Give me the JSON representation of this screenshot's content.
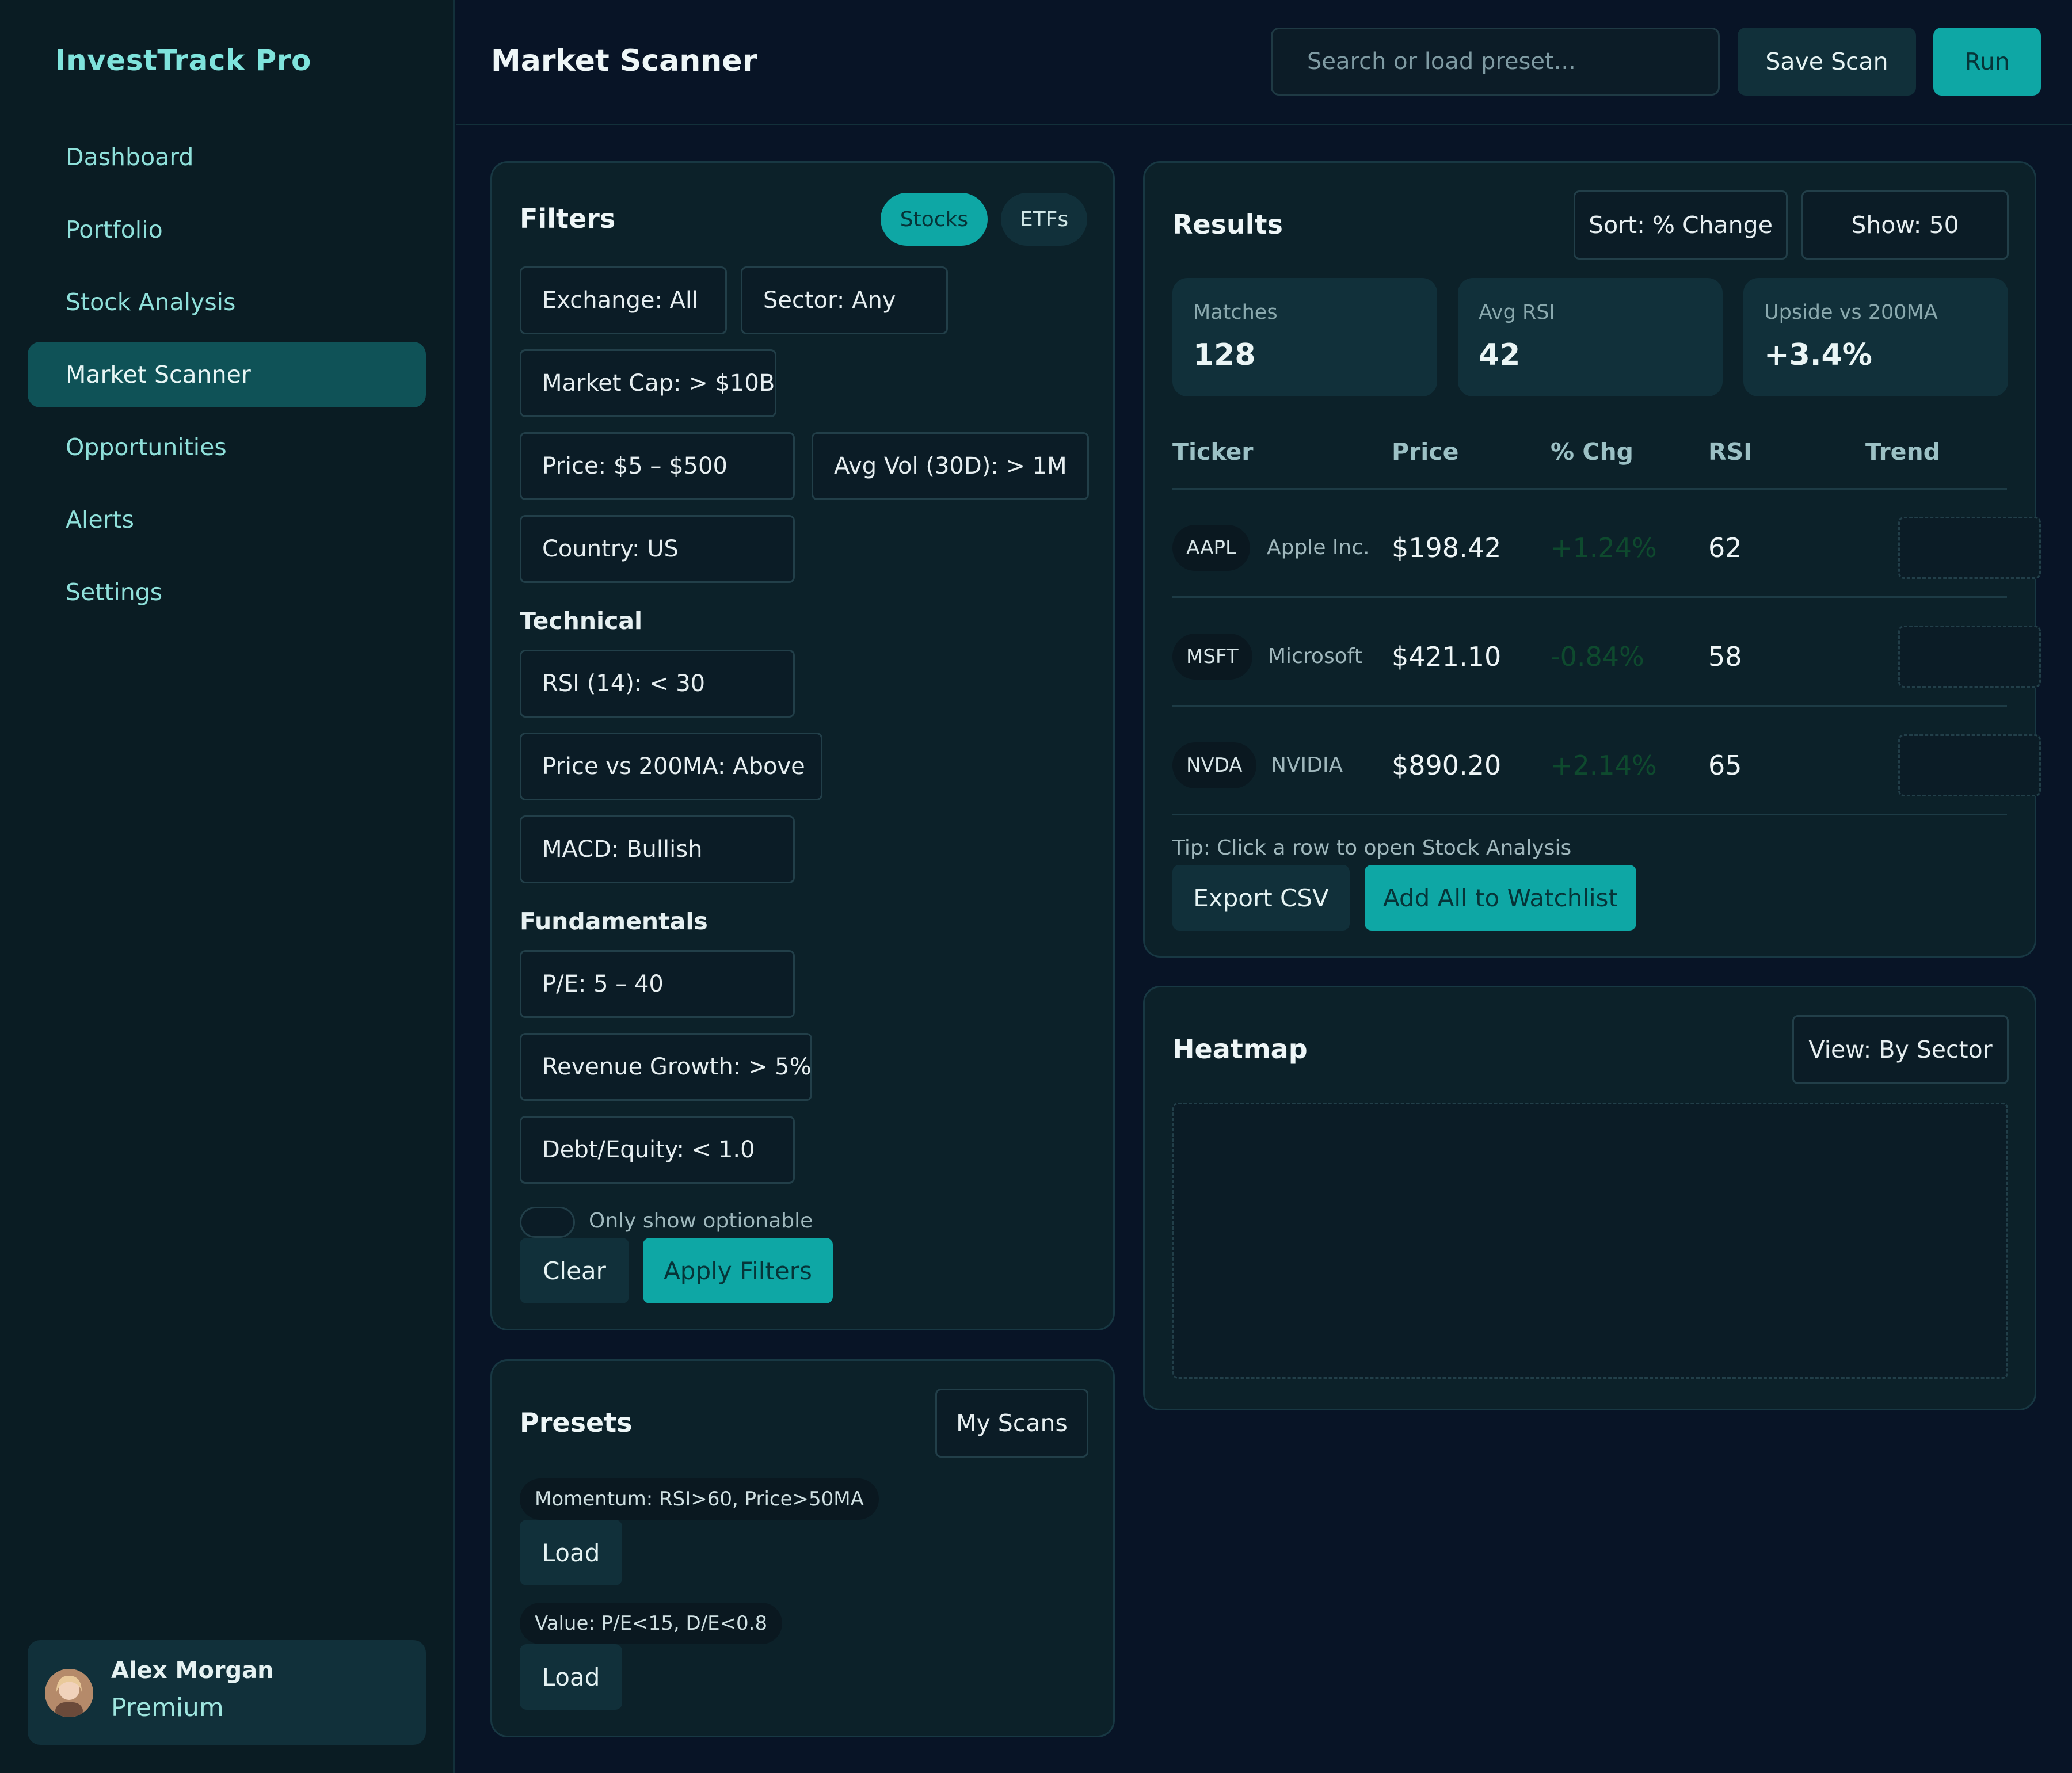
{
  "app": {
    "brand": "InvestTrack Pro"
  },
  "sidebar": {
    "items": [
      {
        "label": "Dashboard",
        "active": false
      },
      {
        "label": "Portfolio",
        "active": false
      },
      {
        "label": "Stock Analysis",
        "active": false
      },
      {
        "label": "Market Scanner",
        "active": true
      },
      {
        "label": "Opportunities",
        "active": false
      },
      {
        "label": "Alerts",
        "active": false
      },
      {
        "label": "Settings",
        "active": false
      }
    ],
    "user": {
      "name": "Alex Morgan",
      "plan": "Premium"
    }
  },
  "header": {
    "title": "Market Scanner",
    "search_placeholder": "Search or load preset...",
    "save_label": "Save Scan",
    "run_label": "Run"
  },
  "filters": {
    "title": "Filters",
    "tabs": {
      "stocks": "Stocks",
      "etfs": "ETFs",
      "active": "Stocks"
    },
    "general": [
      "Exchange: All",
      "Sector: Any",
      "Market Cap: > $10B",
      "Price: $5 – $500",
      "Avg Vol (30D): > 1M",
      "Country: US"
    ],
    "technical_label": "Technical",
    "technical": [
      "RSI (14): < 30",
      "Price vs 200MA: Above",
      "MACD: Bullish"
    ],
    "fundamentals_label": "Fundamentals",
    "fundamentals": [
      "P/E: 5 – 40",
      "Revenue Growth: > 5%",
      "Debt/Equity: < 1.0"
    ],
    "optionable_label": "Only show optionable",
    "optionable": false,
    "clear_label": "Clear",
    "apply_label": "Apply Filters"
  },
  "presets": {
    "title": "Presets",
    "my_scans_label": "My Scans",
    "items": [
      {
        "name": "Momentum: RSI>60, Price>50MA",
        "load_label": "Load"
      },
      {
        "name": "Value: P/E<15, D/E<0.8",
        "load_label": "Load"
      }
    ]
  },
  "results": {
    "title": "Results",
    "sort_label": "Sort: % Change",
    "show_label": "Show: 50",
    "stats": [
      {
        "label": "Matches",
        "value": "128"
      },
      {
        "label": "Avg RSI",
        "value": "42"
      },
      {
        "label": "Upside vs 200MA",
        "value": "+3.4%"
      }
    ],
    "columns": [
      "Ticker",
      "Price",
      "% Chg",
      "RSI",
      "Trend"
    ],
    "rows": [
      {
        "ticker": "AAPL",
        "company": "Apple Inc.",
        "price": "$198.42",
        "chg": "+1.24%",
        "rsi": "62"
      },
      {
        "ticker": "MSFT",
        "company": "Microsoft",
        "price": "$421.10",
        "chg": "-0.84%",
        "rsi": "58"
      },
      {
        "ticker": "NVDA",
        "company": "NVIDIA",
        "price": "$890.20",
        "chg": "+2.14%",
        "rsi": "65"
      }
    ],
    "tip": "Tip: Click a row to open Stock Analysis",
    "export_label": "Export CSV",
    "watchlist_label": "Add All to Watchlist"
  },
  "heatmap": {
    "title": "Heatmap",
    "view_label": "View: By Sector"
  },
  "colors": {
    "accent": "#0ea7a5",
    "background": "#081426",
    "panel": "#0c2129"
  }
}
